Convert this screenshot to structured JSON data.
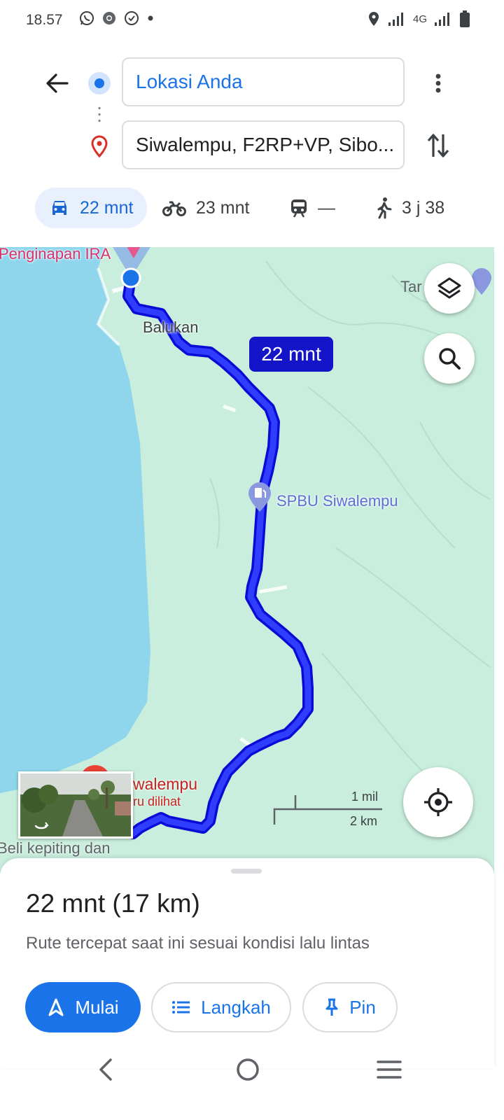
{
  "status_bar": {
    "time": "18.57",
    "network": "4G",
    "icons": [
      "whatsapp-icon",
      "chrome-icon",
      "verified-icon",
      "dot-icon",
      "location-icon",
      "signal-icon",
      "battery-icon"
    ]
  },
  "header": {
    "origin_value": "Lokasi Anda",
    "destination_value": "Siwalempu, F2RP+VP, Sibo..."
  },
  "modes": [
    {
      "name": "car",
      "label": "22 mnt",
      "selected": true
    },
    {
      "name": "motorcycle",
      "label": "23 mnt",
      "selected": false
    },
    {
      "name": "transit",
      "label": "—",
      "selected": false
    },
    {
      "name": "walk",
      "label": "3 j 38",
      "selected": false
    }
  ],
  "map": {
    "places": {
      "lodging": "Penginapan IRA",
      "village": "Balukan",
      "gas_station": "SPBU Siwalempu",
      "partial_top_right": "Tar",
      "destination_name": "walempu",
      "destination_note": "ru dilihat",
      "bottom_left": "Beli kepiting dan"
    },
    "route_label": "22 mnt",
    "scale": {
      "miles": "1 mil",
      "km": "2 km"
    },
    "colors": {
      "route": "#1414e6",
      "water": "#8fd6ec",
      "land": "#c9eedd",
      "pin": "#d93025"
    }
  },
  "sheet": {
    "summary": "22 mnt (17 km)",
    "subtitle": "Rute tercepat saat ini sesuai kondisi lalu lintas",
    "start_label": "Mulai",
    "steps_label": "Langkah",
    "pin_label": "Pin"
  },
  "colors": {
    "accent": "#1a73e8",
    "selected_tab_bg": "#e8f0fe"
  }
}
